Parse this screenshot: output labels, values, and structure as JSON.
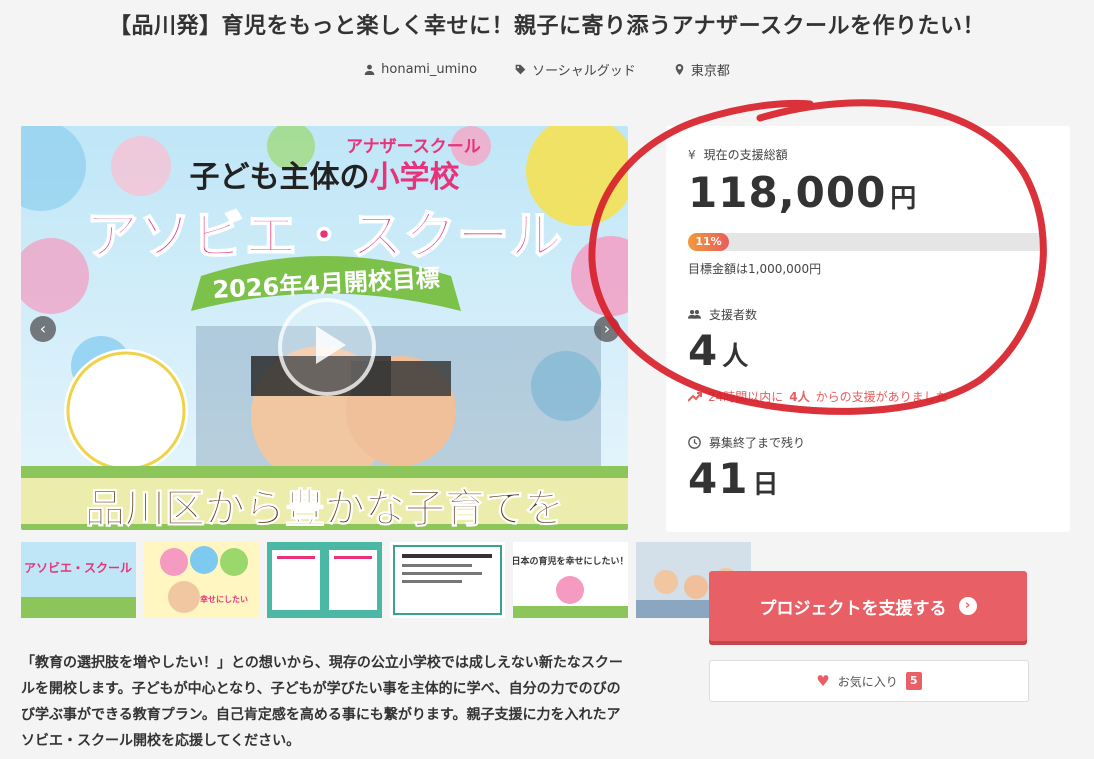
{
  "page": {
    "title": "【品川発】育児をもっと楽しく幸せに！親子に寄り添うアナザースクールを作りたい！"
  },
  "meta": {
    "author": "honami_umino",
    "category": "ソーシャルグッド",
    "location": "東京都"
  },
  "hero": {
    "small_caption": "アナザースクール",
    "line1_prefix": "子ども主体の",
    "line1_pink": "小学校",
    "line2": "アソビエ・スクール",
    "banner": "2026年4月開校目標",
    "bottom": "品川区から豊かな子育てを",
    "prev_label": "‹",
    "next_label": "›"
  },
  "thumbnails": [
    {
      "label": "アソビエ・スクール"
    },
    {
      "label": "幸せにしたい"
    },
    {
      "label": "資料"
    },
    {
      "label": "資料"
    },
    {
      "label": "日本の育児を幸せにしたい！"
    },
    {
      "label": "写真"
    }
  ],
  "description": "「教育の選択肢を増やしたい！」との想いから、現存の公立小学校では成しえない新たなスクールを開校します。子どもが中心となり、子どもが学びたい事を主体的に学べ、自分の力でのびのび学ぶ事ができる教育プラン。自己肯定感を高める事にも繋がります。親子支援に力を入れたアソビエ・スクール開校を応援してください。",
  "stats": {
    "total_label": "現在の支援総額",
    "total_value": "118,000",
    "total_unit": "円",
    "progress_percent": 11,
    "progress_label": "11%",
    "goal_text": "目標金額は1,000,000円",
    "supporters_label": "支援者数",
    "supporters_value": "4",
    "supporters_unit": "人",
    "trend_prefix": "24時間以内に",
    "trend_count": "4人",
    "trend_suffix": "からの支援がありました",
    "remaining_label": "募集終了まで残り",
    "remaining_value": "41",
    "remaining_unit": "日"
  },
  "actions": {
    "support_label": "プロジェクトを支援する",
    "favorite_label": "お気に入り",
    "favorite_count": "5"
  },
  "colors": {
    "accent": "#e85f66",
    "pink": "#e8337a",
    "annotation_red": "#d8202a"
  },
  "icons": {
    "author": "person-icon",
    "category": "tag-icon",
    "location": "pin-icon",
    "yen": "yen-icon",
    "supporters": "group-icon",
    "trend": "trend-up-icon",
    "clock": "clock-icon",
    "arrow": "arrow-right-circle-icon",
    "heart": "heart-icon"
  }
}
